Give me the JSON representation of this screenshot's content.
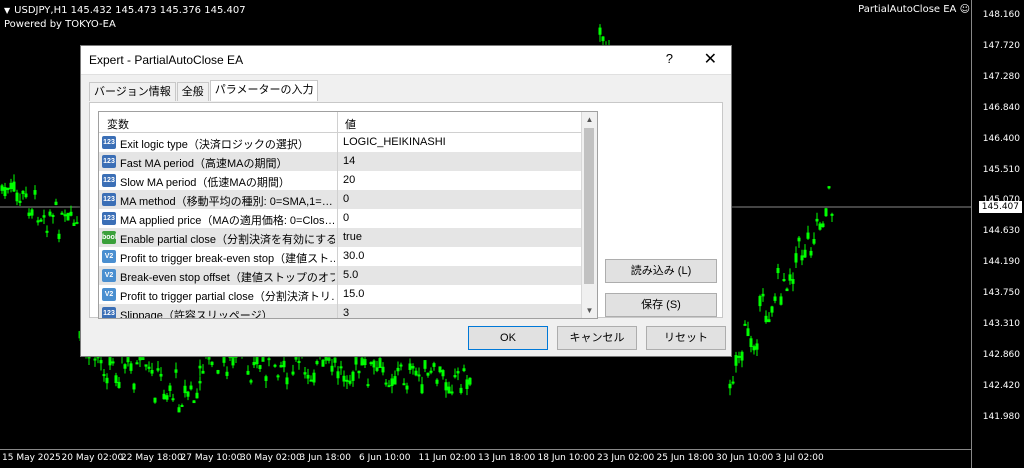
{
  "chart": {
    "symbol_line": "USDJPY,H1  145.432 145.473 145.376 145.407",
    "powered_by": "Powered by TOKYO-EA",
    "ea_label": "PartialAutoClose EA ☺",
    "current_price": "145.407",
    "price_labels": [
      "148.160",
      "147.720",
      "147.280",
      "146.840",
      "146.400",
      "145.510",
      "145.070",
      "144.630",
      "144.190",
      "143.750",
      "143.310",
      "142.860",
      "142.420",
      "141.980"
    ],
    "time_labels": [
      "15 May 2025",
      "20 May 02:00",
      "22 May 18:00",
      "27 May 10:00",
      "30 May 02:00",
      "3 Jun 18:00",
      "6 Jun 10:00",
      "11 Jun 02:00",
      "13 Jun 18:00",
      "18 Jun 10:00",
      "23 Jun 02:00",
      "25 Jun 18:00",
      "30 Jun 10:00",
      "3 Jul 02:00"
    ],
    "candle_color": "#00ff00"
  },
  "dialog": {
    "title": "Expert - PartialAutoClose EA",
    "help": "?",
    "close": "✕",
    "tabs": [
      "バージョン情報",
      "全般",
      "パラメーターの入力"
    ],
    "grid_headers": {
      "name": "変数",
      "value": "値"
    },
    "params": [
      {
        "icon": "123",
        "name": "Exit logic type（決済ロジックの選択）",
        "value": "LOGIC_HEIKINASHI"
      },
      {
        "icon": "123",
        "name": "Fast MA period（高速MAの期間）",
        "value": "14"
      },
      {
        "icon": "123",
        "name": "Slow MA period（低速MAの期間）",
        "value": "20"
      },
      {
        "icon": "123",
        "name": "MA method（移動平均の種別: 0=SMA,1=…",
        "value": "0"
      },
      {
        "icon": "123",
        "name": "MA applied price（MAの適用価格: 0=Clos…",
        "value": "0"
      },
      {
        "icon": "bool",
        "name": "Enable partial close（分割決済を有効にする…",
        "value": "true"
      },
      {
        "icon": "V2",
        "name": "Profit to trigger break-even stop（建値スト…",
        "value": "30.0"
      },
      {
        "icon": "V2",
        "name": "Break-even stop offset（建値ストップのオフ…",
        "value": "5.0"
      },
      {
        "icon": "V2",
        "name": "Profit to trigger partial close（分割決済トリ…",
        "value": "15.0"
      },
      {
        "icon": "123",
        "name": "Slippage（許容スリッページ）",
        "value": "3"
      }
    ],
    "load_button": "読み込み (L)",
    "save_button": "保存 (S)",
    "ok_button": "OK",
    "cancel_button": "キャンセル",
    "reset_button": "リセット"
  }
}
